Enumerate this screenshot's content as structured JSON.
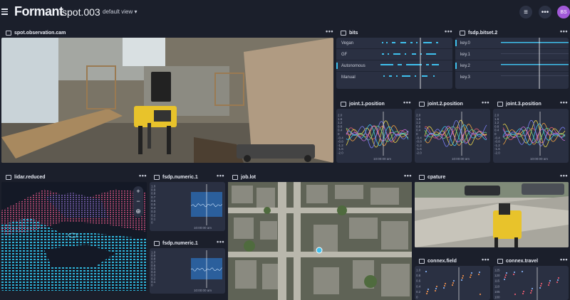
{
  "brand": "Formant",
  "device_name": "spot.003",
  "view_selector": "default view",
  "user_initials": "BS",
  "colors": {
    "accent": "#3fc1ee",
    "avatar": "#a259d9",
    "panel": "#2a3042",
    "bg": "#1b1f2b",
    "chart_fill": "#2b5f9c",
    "key_line": "#3fc1ee"
  },
  "panels": {
    "observation": {
      "title": "spot.observation.cam"
    },
    "bits": {
      "title": "bits",
      "rows": [
        "Vegan",
        "GF",
        "Autonomous",
        "Manual"
      ]
    },
    "bitset": {
      "title": "fsdp.bitset.2",
      "rows": [
        "key.0",
        "key.1",
        "key.2",
        "key.3"
      ]
    },
    "joint1": {
      "title": "joint.1.position",
      "time": "10:00:00 am"
    },
    "joint2": {
      "title": "joint.2.position",
      "time": "10:00:00 am"
    },
    "joint3": {
      "title": "joint.3.position",
      "time": "10:00:00 am"
    },
    "lidar": {
      "title": "lidar.reduced"
    },
    "numeric1": {
      "title": "fsdp.numeric.1",
      "time": "10:00:00 am"
    },
    "numeric2": {
      "title": "fsdp.numeric.1",
      "time": "10:00:00 am"
    },
    "map": {
      "title": "job.lot"
    },
    "capture": {
      "title": "cpature"
    },
    "connex_field": {
      "title": "connex.field"
    },
    "connex_travel": {
      "title": "connex.travel"
    }
  },
  "joint_ticks": [
    "2.0",
    "1.6",
    "1.2",
    "0.8",
    "0.4",
    "0",
    "-0.4",
    "-0.8",
    "-1.2",
    "-1.6",
    "-2.0"
  ],
  "numeric_ticks": [
    "1.0",
    "0.9",
    "0.8",
    "0.7",
    "0.6",
    "0.5",
    "0.4",
    "0.3",
    "0.2",
    "0.1",
    "0"
  ],
  "connex_field_ticks": [
    "1.0",
    "0.8",
    "0.6",
    "0.4",
    "0.2",
    "0"
  ],
  "connex_travel_ticks": [
    "125",
    "120",
    "115",
    "110",
    "105",
    "100"
  ]
}
